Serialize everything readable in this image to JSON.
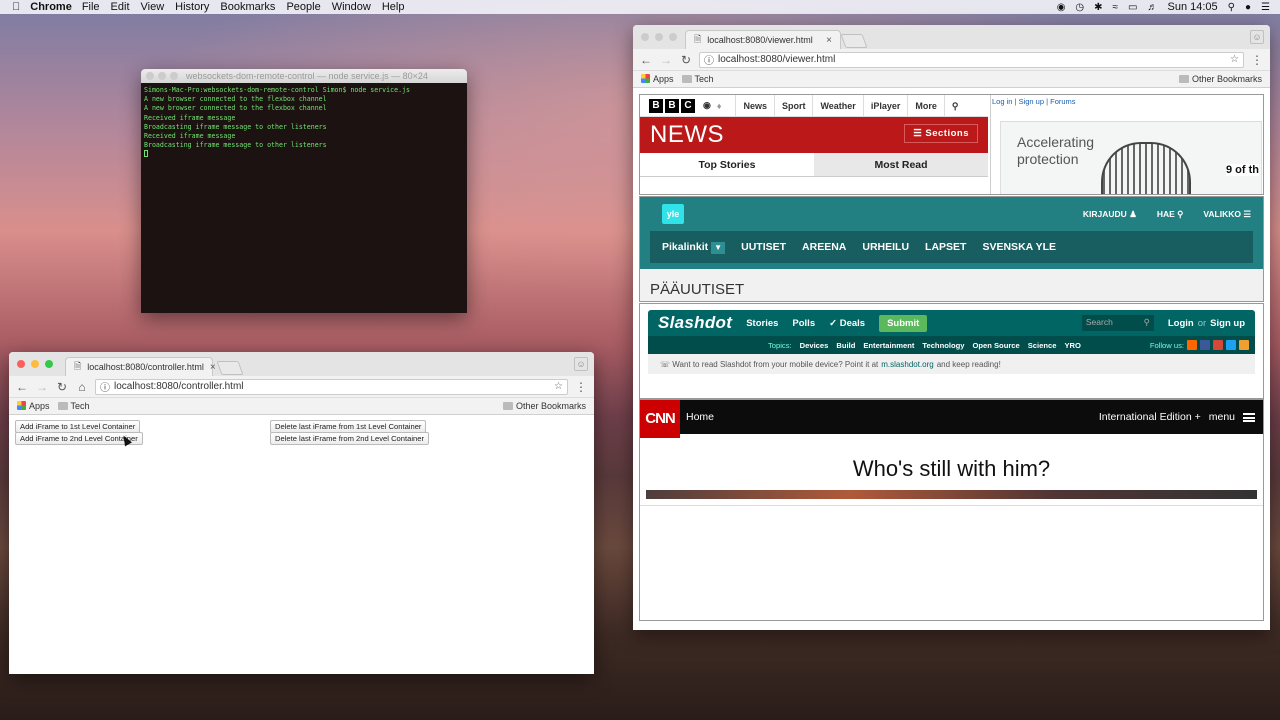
{
  "menubar": {
    "app": "Chrome",
    "items": [
      "File",
      "Edit",
      "View",
      "History",
      "Bookmarks",
      "People",
      "Window",
      "Help"
    ],
    "clock": "Sun 14:05"
  },
  "terminal": {
    "title": "websockets-dom-remote-control — node service.js — 80×24",
    "lines": [
      "Simons-Mac-Pro:websockets-dom-remote-control Simon$ node service.js",
      "A new browser connected to the flexbox channel",
      "A new browser connected to the flexbox channel",
      "Received iframe message",
      "Broadcasting iframe message to other listeners",
      "Received iframe message",
      "Broadcasting iframe message to other listeners"
    ]
  },
  "controller": {
    "tab_title": "localhost:8080/controller.html",
    "url": "localhost:8080/controller.html",
    "bookmarks": {
      "apps": "Apps",
      "tech": "Tech",
      "other": "Other Bookmarks"
    },
    "buttons": {
      "add1": "Add iFrame to 1st Level Container",
      "add2": "Add iFrame to 2nd Level Container",
      "del1": "Delete last iFrame from 1st Level Container",
      "del2": "Delete last iFrame from 2nd Level Container"
    }
  },
  "viewer": {
    "tab_title": "localhost:8080/viewer.html",
    "url": "localhost:8080/viewer.html",
    "bookmarks": {
      "apps": "Apps",
      "tech": "Tech",
      "other": "Other Bookmarks"
    },
    "bbc": {
      "logo": [
        "B",
        "B",
        "C"
      ],
      "nav": [
        "News",
        "Sport",
        "Weather",
        "iPlayer",
        "More"
      ],
      "news": "NEWS",
      "sections": "Sections",
      "tabs": [
        "Top Stories",
        "Most Read"
      ],
      "links": [
        "Log in",
        "Sign up",
        "Forums"
      ],
      "ad_text": "Accelerating protection",
      "ad_tail": "9 of th"
    },
    "yle": {
      "logo": "yle",
      "top": [
        "KIRJAUDU",
        "HAE",
        "VALIKKO"
      ],
      "nav": [
        "Pikalinkit",
        "UUTISET",
        "AREENA",
        "URHEILU",
        "LAPSET",
        "SVENSKA YLE"
      ],
      "title": "PÄÄUUTISET"
    },
    "slashdot": {
      "logo": "Slashdot",
      "nav": [
        "Stories",
        "Polls",
        "Deals"
      ],
      "submit": "Submit",
      "search": "Search",
      "login": "Login",
      "or": "or",
      "signup": "Sign up",
      "topics_label": "Topics:",
      "topics": [
        "Devices",
        "Build",
        "Entertainment",
        "Technology",
        "Open Source",
        "Science",
        "YRO"
      ],
      "follow": "Follow us:",
      "msg_pre": "Want to read Slashdot from your mobile device? Point it at",
      "msg_link": "m.slashdot.org",
      "msg_post": "and keep reading!"
    },
    "cnn": {
      "logo": "CNN",
      "home": "Home",
      "edition": "International Edition +",
      "menu": "menu",
      "headline": "Who's still with him?"
    }
  }
}
